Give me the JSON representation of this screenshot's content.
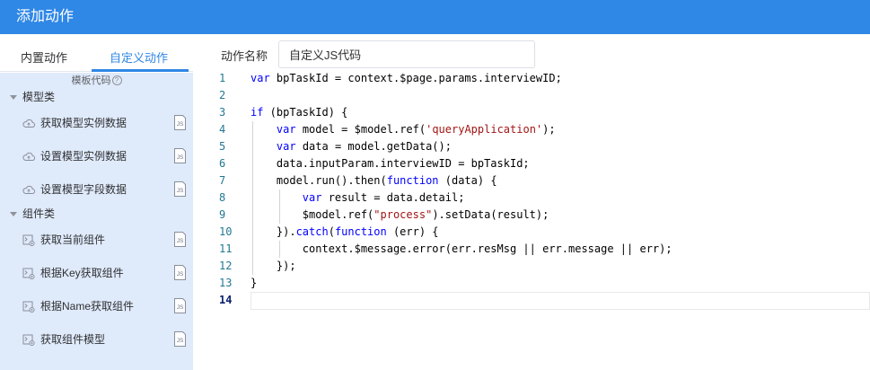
{
  "window": {
    "title": "添加动作"
  },
  "tabs": {
    "builtin": "内置动作",
    "custom": "自定义动作"
  },
  "templates": {
    "header": "模板代码",
    "help_glyph": "?",
    "groups": [
      {
        "label": "模型类",
        "items": [
          {
            "label": "获取模型实例数据",
            "icon": "cloud-icon"
          },
          {
            "label": "设置模型实例数据",
            "icon": "cloud-icon"
          },
          {
            "label": "设置模型字段数据",
            "icon": "cloud-icon"
          }
        ]
      },
      {
        "label": "组件类",
        "items": [
          {
            "label": "获取当前组件",
            "icon": "component-icon"
          },
          {
            "label": "根据Key获取组件",
            "icon": "component-icon"
          },
          {
            "label": "根据Name获取组件",
            "icon": "component-icon"
          },
          {
            "label": "获取组件模型",
            "icon": "component-icon"
          }
        ]
      }
    ],
    "js_badge": "JS"
  },
  "action": {
    "name_label": "动作名称",
    "name_value": "自定义JS代码"
  },
  "editor": {
    "current_line": 14,
    "lines": [
      "var bpTaskId = context.$page.params.interviewID;",
      "",
      "if (bpTaskId) {",
      "    var model = $model.ref('queryApplication');",
      "    var data = model.getData();",
      "    data.inputParam.interviewID = bpTaskId;",
      "    model.run().then(function (data) {",
      "        var result = data.detail;",
      "        $model.ref(\"process\").setData(result);",
      "    }).catch(function (err) {",
      "        context.$message.error(err.resMsg || err.message || err);",
      "    });",
      "}",
      ""
    ]
  },
  "colors": {
    "accent": "#2f87e6",
    "panel": "#dfeafb",
    "keyword": "#0000ff",
    "string": "#a31515"
  }
}
